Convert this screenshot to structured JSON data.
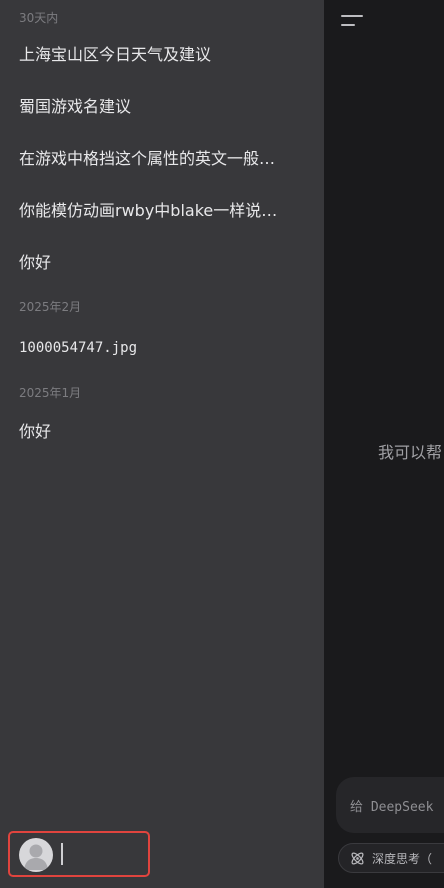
{
  "drawer": {
    "sections": [
      {
        "label": "30天内",
        "items": [
          "上海宝山区今日天气及建议",
          "蜀国游戏名建议",
          "在游戏中格挡这个属性的英文一般…",
          "你能模仿动画rwby中blake一样说…",
          "你好"
        ]
      },
      {
        "label": "2025年2月",
        "items": [
          "1000054747.jpg"
        ]
      },
      {
        "label": "2025年1月",
        "items": [
          "你好"
        ]
      }
    ]
  },
  "main": {
    "greeting": "我可以帮",
    "input_placeholder": "给 DeepSeek",
    "deep_think_label": "深度思考（"
  }
}
